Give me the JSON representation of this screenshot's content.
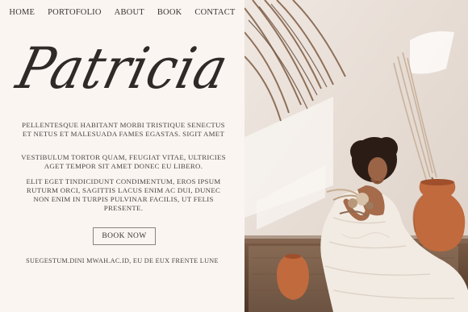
{
  "nav": {
    "items": [
      "HOME",
      "PORTOFOLIO",
      "ABOUT",
      "BOOK",
      "CONTACT"
    ]
  },
  "brand": {
    "name": "Patricia"
  },
  "intro": {
    "p1": "Pellentesque habitant morbi tristique senectus et netus et malesuada fames egastas. sigit amet",
    "p2": "Vestibulum tortor quam, feugiat vitae, ultricies aget tempor sit amet donec eu libero.",
    "p3": "Elit eget tindicidunt condimentum, eros ipsum ruturm orci, sagittis lacus enim ac dui, dunec non enim in turpis pulvinar facilis, ut felis presente."
  },
  "cta": {
    "label": "BOOK NOW"
  },
  "footer": {
    "text": "suegestum.dini mwah.ac.id, eu de eux frente lune"
  },
  "colors": {
    "background": "#fbf5f2",
    "text": "#3b3431",
    "wall": "#e9e0d9",
    "floor": "#6b4b36",
    "terracotta": "#c06a3e"
  }
}
